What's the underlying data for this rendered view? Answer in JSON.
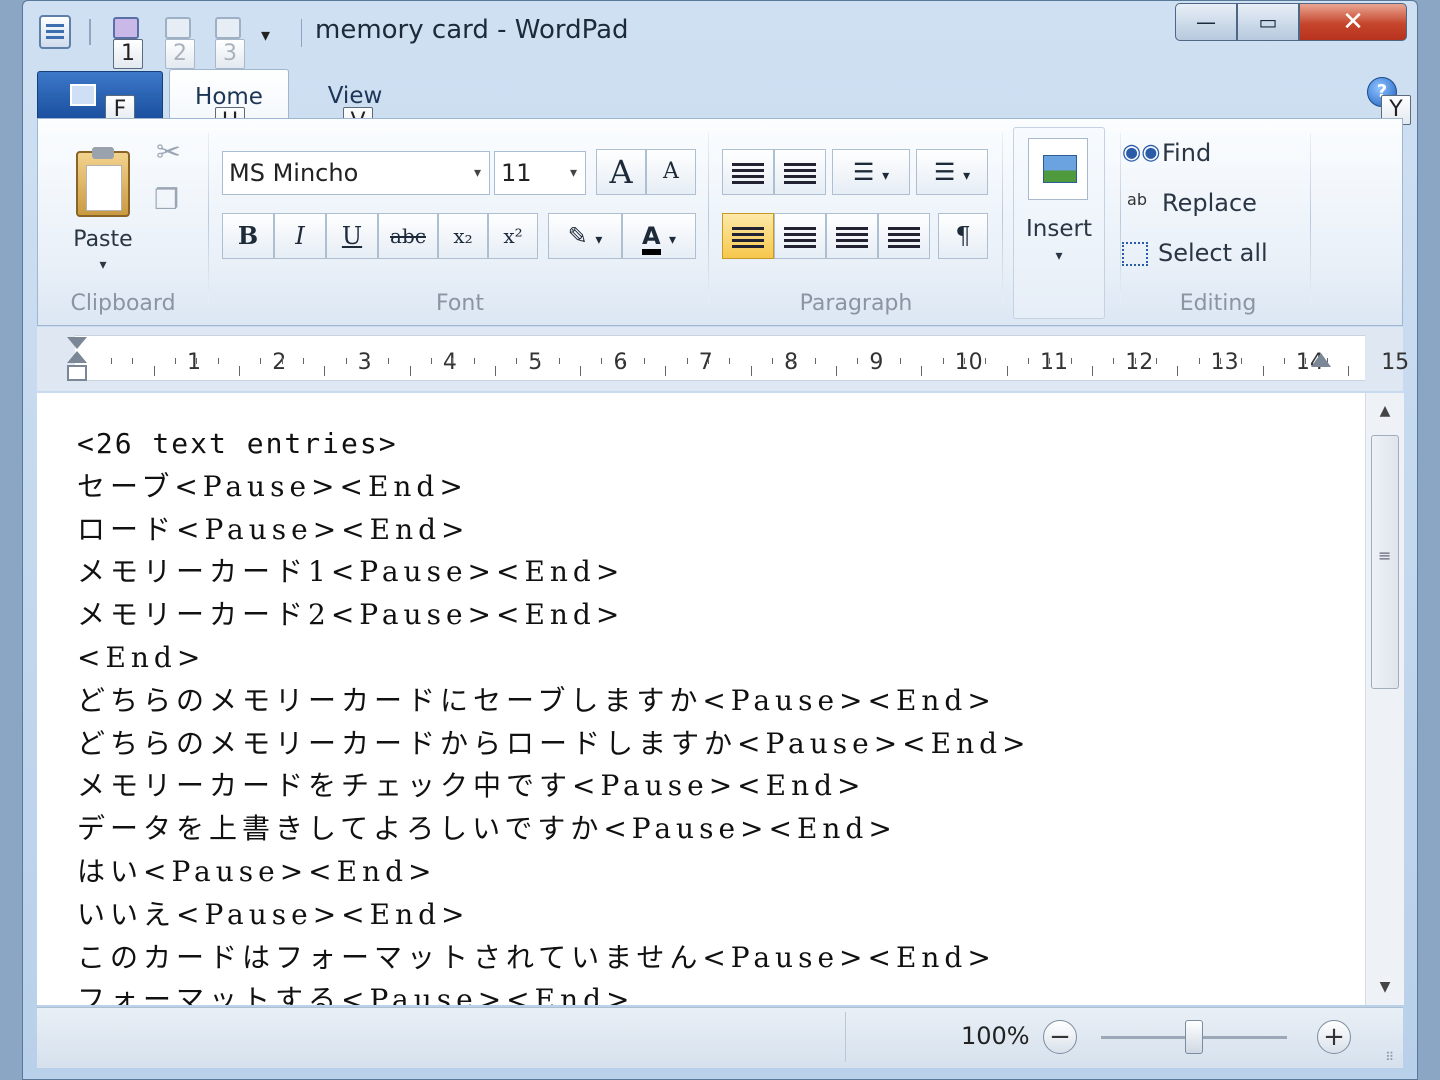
{
  "window": {
    "title": "memory card - WordPad"
  },
  "quick_access": {
    "keytips": [
      "1",
      "2",
      "3"
    ],
    "dropdown_glyph": "▾"
  },
  "window_controls": {
    "minimize": "—",
    "maximize": "▭",
    "close": "✕"
  },
  "tabs": {
    "file_keytip": "F",
    "home_label": "Home",
    "home_keytip": "H",
    "view_label": "View",
    "view_keytip": "V",
    "help_keytip": "Y",
    "help_glyph": "?"
  },
  "clipboard": {
    "group_label": "Clipboard",
    "paste_label": "Paste",
    "cut_glyph": "✂",
    "copy_glyph": "❐",
    "dropdown_glyph": "▾"
  },
  "font": {
    "group_label": "Font",
    "font_name": "MS Mincho",
    "font_size": "11",
    "grow_glyph": "A",
    "shrink_glyph": "A",
    "bold": "B",
    "italic": "I",
    "underline": "U",
    "strikethrough": "abc",
    "subscript": "x₂",
    "superscript": "x²",
    "highlight_glyph": "✎",
    "color_glyph": "A",
    "dropdown_glyph": "▾",
    "text_color": "#000000",
    "highlight_color": "#ffffff"
  },
  "paragraph": {
    "group_label": "Paragraph",
    "list_glyph": "☰",
    "pilcrow_glyph": "¶"
  },
  "insert": {
    "label": "Insert",
    "dropdown_glyph": "▾"
  },
  "editing": {
    "group_label": "Editing",
    "find": "Find",
    "replace": "Replace",
    "select_all": "Select all"
  },
  "ruler": {
    "numbers": [
      "1",
      "2",
      "3",
      "4",
      "5",
      "6",
      "7",
      "8",
      "9",
      "10",
      "11",
      "12",
      "13",
      "14",
      "15"
    ]
  },
  "document": {
    "lines": [
      "<26 text entries>",
      "セーブ<Pause><End>",
      "ロード<Pause><End>",
      "メモリーカード1<Pause><End>",
      "メモリーカード2<Pause><End>",
      "<End>",
      "どちらのメモリーカードにセーブしますか<Pause><End>",
      "どちらのメモリーカードからロードしますか<Pause><End>",
      "メモリーカードをチェック中です<Pause><End>",
      "データを上書きしてよろしいですか<Pause><End>",
      "はい<Pause><End>",
      "いいえ<Pause><End>",
      "このカードはフォーマットされていません<Pause><End>",
      "フォーマットする<Pause><End>"
    ]
  },
  "scrollbar": {
    "up_glyph": "▲",
    "down_glyph": "▼"
  },
  "statusbar": {
    "zoom": "100%",
    "zoom_out_glyph": "−",
    "zoom_in_glyph": "+",
    "zoom_level": 100,
    "grip_glyph": "⠿"
  },
  "colors": {
    "accent": "#f7c74c",
    "file_tab": "#1a4f9e",
    "close_button": "#c5452d"
  }
}
